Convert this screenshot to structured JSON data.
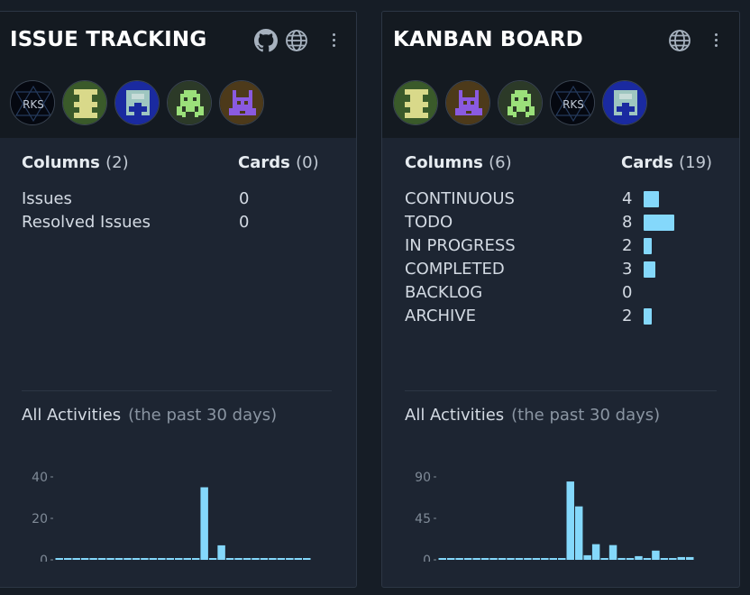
{
  "boards": [
    {
      "title": "ISSUE TRACKING",
      "header_icons": [
        "github-icon",
        "globe-icon",
        "more-vertical-icon"
      ],
      "avatars": [
        "avatar-rks",
        "avatar-yellow-invader",
        "avatar-blue-cross",
        "avatar-green-invader",
        "avatar-purple-invader"
      ],
      "columns_label": "Columns",
      "columns_count": "(2)",
      "cards_label": "Cards",
      "cards_count": "(0)",
      "rows": [
        {
          "label": "Issues",
          "value": "0"
        },
        {
          "label": "Resolved Issues",
          "value": "0"
        }
      ],
      "activities_label": "All Activities",
      "activities_sub": "(the past 30 days)",
      "chart_data": {
        "type": "bar",
        "title": "",
        "xlabel": "",
        "ylabel": "",
        "y_ticks": [
          "40",
          "20",
          "0"
        ],
        "ylim": [
          0,
          40
        ],
        "values": [
          0,
          0,
          0,
          0,
          0,
          0,
          0,
          0,
          0,
          0,
          0,
          0,
          0,
          0,
          0,
          0,
          0,
          35,
          0,
          7,
          0,
          0,
          0,
          0,
          0,
          0,
          0,
          0,
          0,
          0
        ],
        "bar_color": "#84d8fb"
      }
    },
    {
      "title": "KANBAN BOARD",
      "header_icons": [
        "globe-icon",
        "more-vertical-icon"
      ],
      "avatars": [
        "avatar-yellow-invader",
        "avatar-purple-invader",
        "avatar-green-invader",
        "avatar-rks",
        "avatar-blue-cross"
      ],
      "columns_label": "Columns",
      "columns_count": "(6)",
      "cards_label": "Cards",
      "cards_count": "(19)",
      "rows": [
        {
          "label": "CONTINUOUS",
          "value": "4",
          "bar": 4
        },
        {
          "label": "TODO",
          "value": "8",
          "bar": 8
        },
        {
          "label": "IN PROGRESS",
          "value": "2",
          "bar": 2
        },
        {
          "label": "COMPLETED",
          "value": "3",
          "bar": 3
        },
        {
          "label": "BACKLOG",
          "value": "0",
          "bar": 0
        },
        {
          "label": "ARCHIVE",
          "value": "2",
          "bar": 2
        }
      ],
      "activities_label": "All Activities",
      "activities_sub": "(the past 30 days)",
      "chart_data": {
        "type": "bar",
        "title": "",
        "xlabel": "",
        "ylabel": "",
        "y_ticks": [
          "90",
          "45",
          "0"
        ],
        "ylim": [
          0,
          90
        ],
        "values": [
          0,
          0,
          0,
          0,
          0,
          0,
          0,
          0,
          0,
          0,
          0,
          0,
          0,
          0,
          0,
          85,
          58,
          5,
          17,
          0,
          16,
          2,
          0,
          4,
          1,
          10,
          1,
          0,
          3,
          3
        ],
        "bar_color": "#84d8fb"
      }
    }
  ]
}
